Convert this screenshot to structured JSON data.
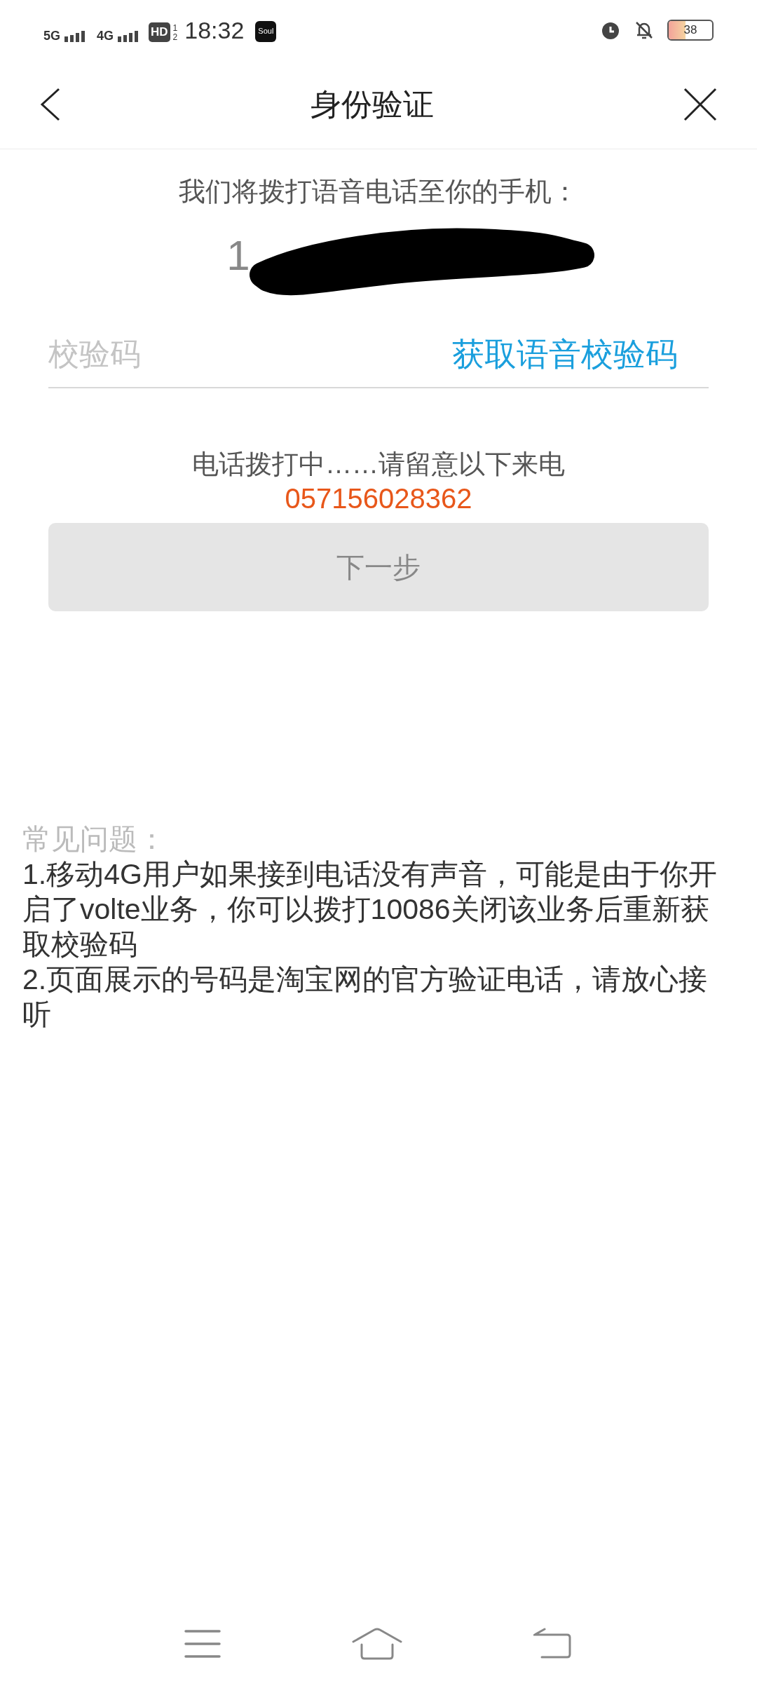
{
  "status_bar": {
    "network_1": "5G",
    "network_2": "4G",
    "hd": "HD",
    "hd_sub_1": "1",
    "hd_sub_2": "2",
    "time": "18:32",
    "app_badge": "Soul",
    "battery": "38"
  },
  "header": {
    "title": "身份验证"
  },
  "intro": "我们将拨打语音电话至你的手机：",
  "phone": {
    "visible_start": "1",
    "redacted": true
  },
  "code_field": {
    "placeholder": "校验码",
    "action": "获取语音校验码"
  },
  "call_status": "电话拨打中……请留意以下来电",
  "caller_number": "057156028362",
  "next_button": {
    "label": "下一步",
    "disabled": true
  },
  "faq": {
    "title": "常见问题：",
    "items": [
      "1.移动4G用户如果接到电话没有声音，可能是由于你开启了volte业务，你可以拨打10086关闭该业务后重新获取校验码",
      "2.页面展示的号码是淘宝网的官方验证电话，请放心接听"
    ]
  }
}
